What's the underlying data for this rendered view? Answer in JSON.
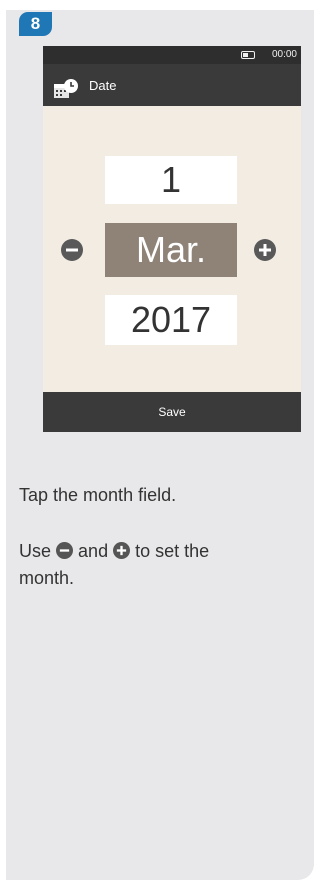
{
  "step": {
    "number": "8"
  },
  "device": {
    "status_time": "00:00",
    "screen_title": "Date",
    "day": "1",
    "month": "Mar.",
    "year": "2017",
    "save_label": "Save",
    "colors": {
      "selected_field": "#8f8277",
      "bars": "#3a3a3a",
      "background": "#f2ece3"
    }
  },
  "instructions": {
    "line1": "Tap the month field.",
    "line2_prefix": "Use",
    "line2_and": "and",
    "line2_suffix": "to set the month."
  },
  "badge_color": "#1f77b6"
}
